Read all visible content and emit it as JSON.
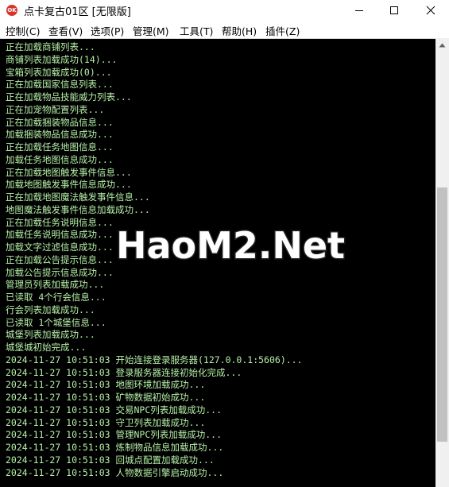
{
  "window": {
    "title": "点卡复古01区 [无限版]",
    "icon_label": "OK",
    "controls": [
      "minimize-icon",
      "maximize-icon",
      "close-icon"
    ]
  },
  "menu": {
    "items": [
      {
        "label": "控制(C)"
      },
      {
        "label": "查看(V)"
      },
      {
        "label": "选项(P)"
      },
      {
        "label": "管理(M)"
      },
      {
        "label": "工具(T)"
      },
      {
        "label": "帮助(H)"
      },
      {
        "label": "插件(Z)"
      }
    ]
  },
  "console": {
    "text_color": "#b6f0a8",
    "background": "#000000",
    "lines": [
      "正在加载商铺列表...",
      "商铺列表加载成功(14)...",
      "宝箱列表加载成功(0)...",
      "正在加载国家信息列表...",
      "正在加载物品技能威力列表...",
      "正在加宠物配置列表...",
      "正在加载捆装物品信息...",
      "加载捆装物品信息成功...",
      "正在加载任务地图信息...",
      "加载任务地图信息成功...",
      "正在加载地图触发事件信息...",
      "加载地图触发事件信息成功...",
      "正在加载地图魔法触发事件信息...",
      "地图魔法触发事件信息加载成功...",
      "正在加载任务说明信息...",
      "加载任务说明信息成功...",
      "加载文字过滤信息成功...",
      "正在加载公告提示信息...",
      "加载公告提示信息成功...",
      "管理员列表加载成功...",
      "已读取 4个行会信息...",
      "行会列表加载成功...",
      "已读取 1个城堡信息...",
      "城堡列表加载成功...",
      "城堡城初始完成...",
      "2024-11-27 10:51:03 开始连接登录服务器(127.0.0.1:5606)...",
      "2024-11-27 10:51:03 登录服务器连接初始化完成...",
      "2024-11-27 10:51:03 地图环境加载成功...",
      "2024-11-27 10:51:03 矿物数据初始成功...",
      "2024-11-27 10:51:03 交易NPC列表加载成功...",
      "2024-11-27 10:51:03 守卫列表加载成功...",
      "2024-11-27 10:51:03 管理NPC列表加载成功...",
      "2024-11-27 10:51:03 炼制物品信息加载成功...",
      "2024-11-27 10:51:03 回城点配置加载成功...",
      "2024-11-27 10:51:03 人物数据引擎启动成功..."
    ]
  },
  "watermark": {
    "text": "HaoM2.Net"
  }
}
